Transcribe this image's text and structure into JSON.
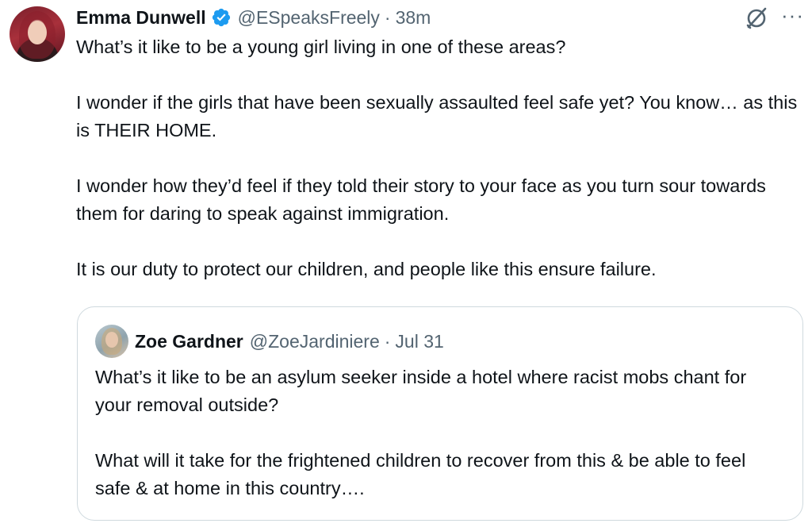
{
  "tweet": {
    "author": {
      "name": "Emma Dunwell",
      "handle": "@ESpeaksFreely",
      "separator": "·",
      "time": "38m"
    },
    "paragraphs": [
      "What’s it like to be a young girl living in one of these areas?",
      "I wonder if the girls that have been sexually assaulted feel safe yet? You know… as this is THEIR HOME.",
      "I wonder how they’d feel if they told their story to your face as you turn sour towards them for daring to speak against immigration.",
      "It is our duty to protect our children, and people like this ensure failure."
    ],
    "icons": {
      "verified": "verified-badge-icon",
      "grok": "grok-icon",
      "more": "more-icon"
    },
    "more_glyph": "···"
  },
  "quoted": {
    "author": {
      "name": "Zoe Gardner",
      "handle": "@ZoeJardiniere",
      "separator": "·",
      "time": "Jul 31"
    },
    "paragraphs": [
      "What’s it like to be an asylum seeker inside a hotel where racist mobs chant for your removal outside?",
      "What will it take for the frightened children to recover from this & be able to feel safe & at home in this country…."
    ]
  },
  "colors": {
    "verified": "#1d9bf0",
    "text": "#0f1419",
    "secondary": "#536471",
    "border": "#cfd9de"
  }
}
